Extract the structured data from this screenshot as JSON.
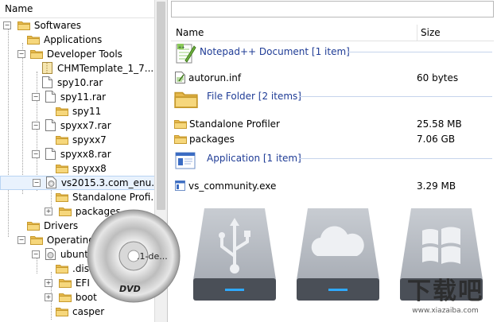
{
  "tree": {
    "header": "Name",
    "items": [
      {
        "label": "Softwares"
      },
      {
        "label": "Applications"
      },
      {
        "label": "Developer Tools"
      },
      {
        "label": "CHMTemplate_1_7..."
      },
      {
        "label": "spy10.rar"
      },
      {
        "label": "spy11.rar"
      },
      {
        "label": "spy11"
      },
      {
        "label": "spyxx7.rar"
      },
      {
        "label": "spyxx7"
      },
      {
        "label": "spyxx8.rar"
      },
      {
        "label": "spyxx8"
      },
      {
        "label": "vs2015.3.com_enu..."
      },
      {
        "label": "Standalone Profi..."
      },
      {
        "label": "packages"
      },
      {
        "label": "Drivers"
      },
      {
        "label": "Operating S"
      },
      {
        "label": "ubuntu"
      },
      {
        "label": ".disk"
      },
      {
        "label": "EFI"
      },
      {
        "label": "boot"
      },
      {
        "label": "casper"
      }
    ]
  },
  "list": {
    "columns": {
      "name": "Name",
      "size": "Size"
    },
    "groups": [
      {
        "title": "Notepad++ Document [1 item]",
        "files": [
          {
            "name": "autorun.inf",
            "size": "60 bytes"
          }
        ]
      },
      {
        "title": "File Folder [2 items]",
        "files": [
          {
            "name": "Standalone Profiler",
            "size": "25.58 MB"
          },
          {
            "name": "packages",
            "size": "7.06 GB"
          }
        ]
      },
      {
        "title": "Application [1 item]",
        "files": [
          {
            "name": "vs_community.exe",
            "size": "3.29 MB"
          }
        ]
      }
    ]
  },
  "overlay": {
    "dvd_label": "DVD",
    "dvd_text": ".1-de...",
    "watermark_brand": "下载吧",
    "watermark_url": "www.xiazaiba.com"
  },
  "colors": {
    "group_title": "#1f3c96",
    "folder": "#f3cf6e",
    "selection": "#dcebfc"
  }
}
